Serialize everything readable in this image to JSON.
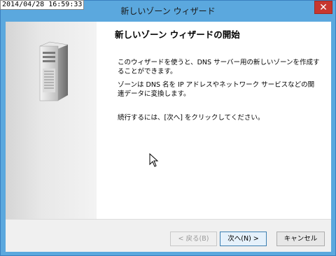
{
  "overlay": {
    "timestamp": "2014/04/28 16:59:33"
  },
  "window": {
    "title": "新しいゾーン ウィザード",
    "close_label": "✕"
  },
  "content": {
    "heading": "新しいゾーン ウィザードの開始",
    "paragraph1": "このウィザードを使うと、DNS サーバー用の新しいゾーンを作成することができます。",
    "paragraph2": "ゾーンは DNS 名を IP アドレスやネットワーク サービスなどの関連データに変換します。",
    "paragraph3": "続行するには、[次へ] をクリックしてください。"
  },
  "buttons": {
    "back": "< 戻る(B)",
    "next": "次へ(N) >",
    "cancel": "キャンセル"
  },
  "icons": {
    "wizard": "server-icon",
    "close": "close-icon",
    "pointer": "mouse-cursor-icon"
  },
  "colors": {
    "titlebar": "#5ba8de",
    "close": "#c7372f"
  }
}
